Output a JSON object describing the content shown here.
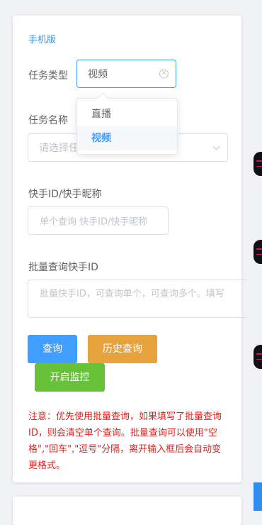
{
  "form": {
    "title": "手机版",
    "task_type": {
      "label": "任务类型",
      "value": "视频",
      "options": [
        "直播",
        "视频"
      ]
    },
    "task_name": {
      "label": "任务名称",
      "placeholder": "请选择任"
    },
    "kuaishou_id": {
      "label": "快手ID/快手昵称",
      "placeholder": "单个查询 快手ID/快手昵称"
    },
    "batch": {
      "label": "批量查询快手ID",
      "placeholder": "批量快手ID，可查询单个，可查询多个。填写"
    },
    "buttons": {
      "query": "查询",
      "history": "历史查询",
      "monitor": "开启监控"
    },
    "notice": "注意：优先使用批量查询，如果填写了批量查询ID，则会清空单个查询。批量查询可以使用\"空格\",\"回车\",\"逗号\"分隔，离开输入框后会自动变更格式。"
  },
  "colors": {
    "primary": "#409eff",
    "warning": "#e6a23c",
    "success": "#67c23a",
    "notice": "#e0201c"
  }
}
